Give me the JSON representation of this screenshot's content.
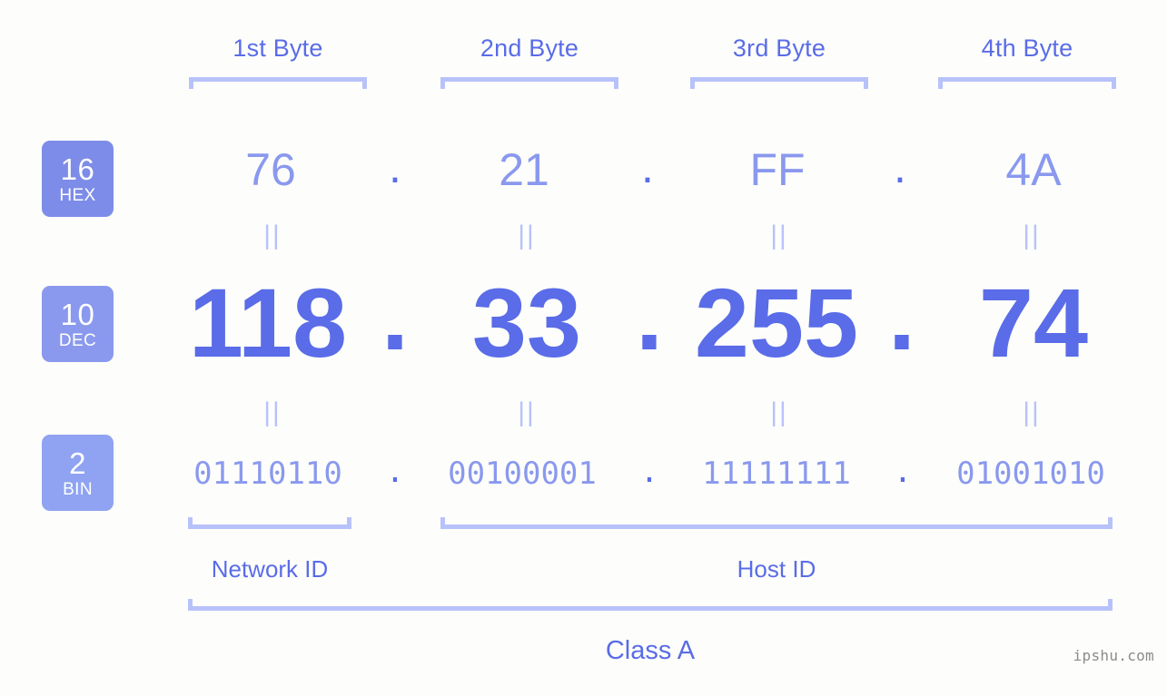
{
  "background_color": "#fdfefb",
  "accent_color": "#5a6ce8",
  "accent_light_color": "#8a99ee",
  "bracket_color": "#b8c2fa",
  "byte_headers": [
    {
      "label": "1st Byte"
    },
    {
      "label": "2nd Byte"
    },
    {
      "label": "3rd Byte"
    },
    {
      "label": "4th Byte"
    }
  ],
  "rows": {
    "hex": {
      "badge_num": "16",
      "badge_sub": "HEX",
      "badge_color": "#7d8ce8",
      "values": [
        "76",
        "21",
        "FF",
        "4A"
      ],
      "separator": "."
    },
    "dec": {
      "badge_num": "10",
      "badge_sub": "DEC",
      "badge_color": "#8a99ee",
      "values": [
        "118",
        "33",
        "255",
        "74"
      ],
      "separator": "."
    },
    "bin": {
      "badge_num": "2",
      "badge_sub": "BIN",
      "badge_color": "#8fa3f2",
      "values": [
        "01110110",
        "00100001",
        "11111111",
        "01001010"
      ],
      "separator": "."
    }
  },
  "equals_marks": [
    "||",
    "||",
    "||",
    "||",
    "||",
    "||",
    "||",
    "||"
  ],
  "segments": {
    "network_id": "Network ID",
    "host_id": "Host ID",
    "class": "Class A"
  },
  "watermark": "ipshu.com"
}
